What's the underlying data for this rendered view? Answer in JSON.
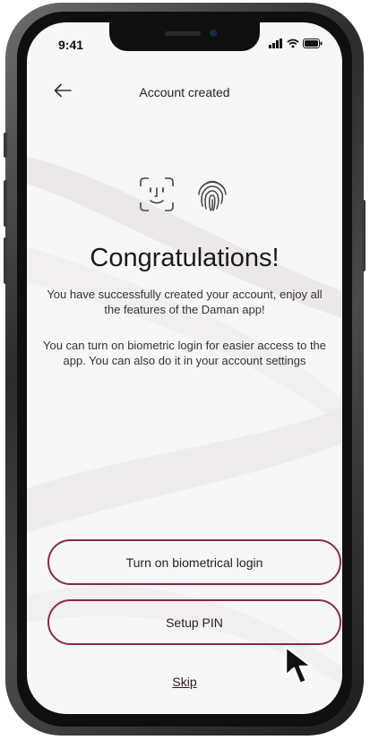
{
  "status_bar": {
    "time": "9:41",
    "icons": [
      "signal-icon",
      "wifi-icon",
      "battery-icon"
    ]
  },
  "header": {
    "back_icon": "back-arrow-icon",
    "title": "Account created"
  },
  "biometrics": {
    "icons": [
      "face-id-icon",
      "fingerprint-icon"
    ]
  },
  "content": {
    "heading": "Congratulations!",
    "paragraph_1": "You have successfully created your account, enjoy all the features of the Daman app!",
    "paragraph_2": "You can turn on biometric login for easier access to the app. You can also do it in your account settings"
  },
  "actions": {
    "biometric_label": "Turn on biometrical login",
    "pin_label": "Setup PIN",
    "skip_label": "Skip"
  },
  "colors": {
    "accent": "#8a2a3e",
    "background": "#f7f7f8"
  }
}
